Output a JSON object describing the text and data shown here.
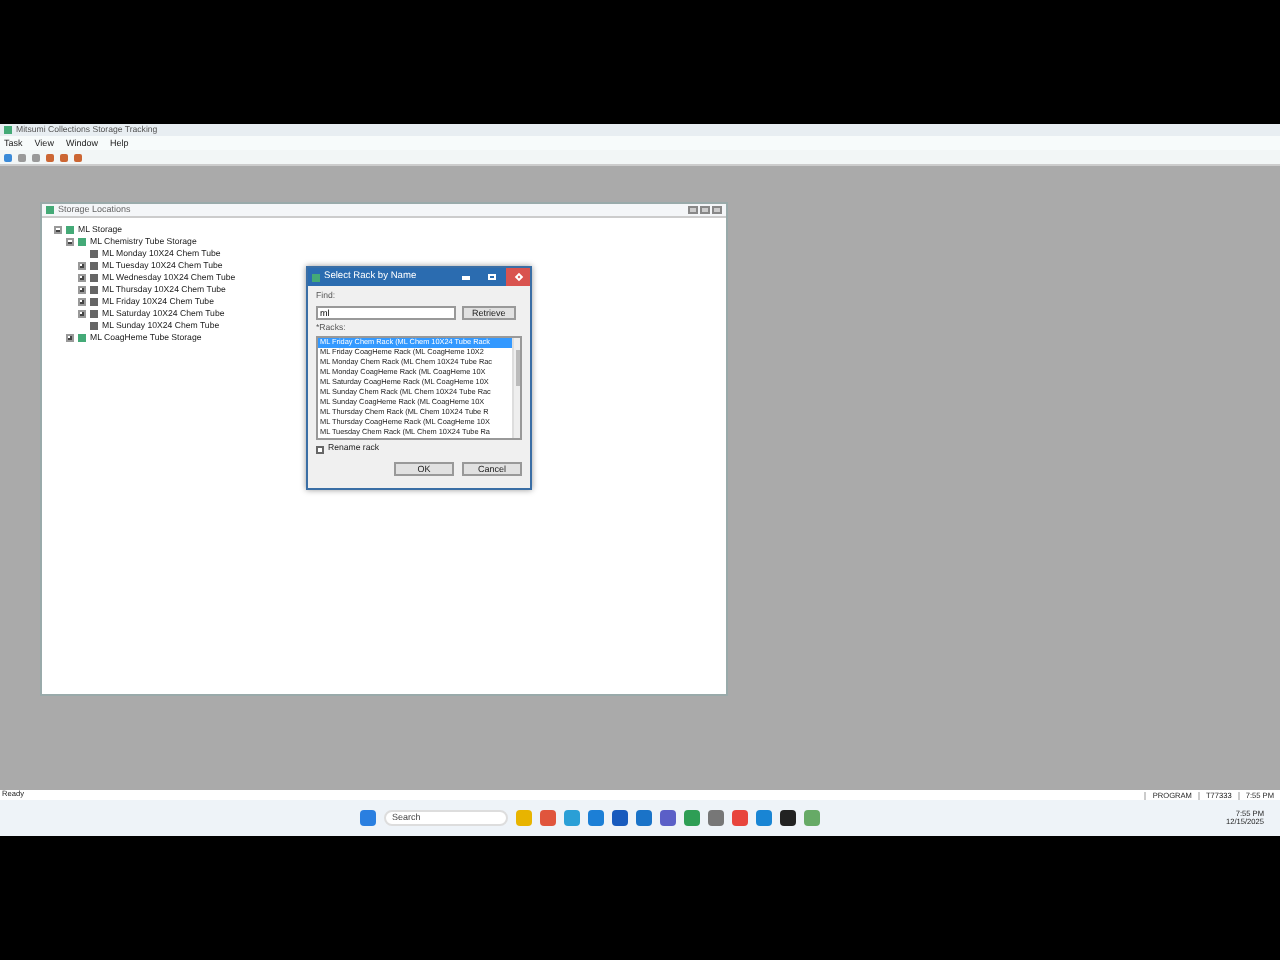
{
  "app": {
    "title": "Mitsumi Collections Storage Tracking"
  },
  "menu": [
    "Task",
    "View",
    "Window",
    "Help"
  ],
  "child_window": {
    "title": "Storage Locations"
  },
  "tree": [
    {
      "label": "ML Storage",
      "expanded": true,
      "children": [
        {
          "label": "ML Chemistry Tube Storage",
          "expanded": true,
          "children": [
            {
              "label": "ML Monday 10X24 Chem Tube"
            },
            {
              "label": "ML Tuesday 10X24 Chem Tube",
              "expanded": false
            },
            {
              "label": "ML Wednesday 10X24 Chem Tube",
              "expanded": false
            },
            {
              "label": "ML Thursday 10X24 Chem Tube",
              "expanded": false
            },
            {
              "label": "ML Friday 10X24 Chem Tube",
              "expanded": false
            },
            {
              "label": "ML Saturday 10X24 Chem Tube",
              "expanded": false
            },
            {
              "label": "ML Sunday 10X24 Chem Tube"
            }
          ]
        },
        {
          "label": "ML CoagHeme Tube Storage",
          "expanded": false
        }
      ]
    }
  ],
  "dialog": {
    "title": "Select Rack by Name",
    "find_label": "Find:",
    "find_value": "ml",
    "retrieve": "Retrieve",
    "racks_label": "*Racks:",
    "racks": [
      {
        "label": "ML Friday Chem Rack (ML Chem 10X24 Tube Rack",
        "selected": true
      },
      {
        "label": "ML Friday CoagHeme Rack (ML CoagHeme 10X2",
        "selected": false
      },
      {
        "label": "ML Monday Chem Rack (ML Chem 10X24 Tube Rac",
        "selected": false
      },
      {
        "label": "ML Monday CoagHeme Rack (ML CoagHeme 10X",
        "selected": false
      },
      {
        "label": "ML Saturday CoagHeme Rack (ML CoagHeme 10X",
        "selected": false
      },
      {
        "label": "ML Sunday Chem Rack (ML Chem 10X24 Tube Rac",
        "selected": false
      },
      {
        "label": "ML Sunday CoagHeme Rack (ML CoagHeme 10X",
        "selected": false
      },
      {
        "label": "ML Thursday Chem Rack (ML Chem 10X24 Tube R",
        "selected": false
      },
      {
        "label": "ML Thursday CoagHeme Rack (ML CoagHeme 10X",
        "selected": false
      },
      {
        "label": "ML Tuesday Chem Rack (ML Chem 10X24 Tube Ra",
        "selected": false
      }
    ],
    "rename": {
      "label": "Rename rack",
      "checked": false
    },
    "ok": "OK",
    "cancel": "Cancel"
  },
  "status_bar": [
    "Ready",
    "PROGRAM",
    "T77333",
    "7:55 PM"
  ],
  "taskbar": {
    "search": "Search",
    "time": "7:55 PM",
    "date": "12/15/2025"
  }
}
